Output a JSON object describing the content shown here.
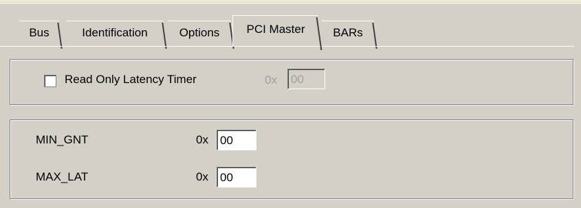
{
  "tabs": [
    {
      "label": "Bus",
      "active": false
    },
    {
      "label": "Identification",
      "active": false
    },
    {
      "label": "Options",
      "active": false
    },
    {
      "label": "PCI Master",
      "active": true
    },
    {
      "label": "BARs",
      "active": false
    }
  ],
  "latency_group": {
    "checkbox_label": "Read Only Latency Timer",
    "checkbox_checked": false,
    "hex_prefix": "0x",
    "value": "00"
  },
  "master_group": {
    "rows": [
      {
        "label": "MIN_GNT",
        "hex_prefix": "0x",
        "value": "00"
      },
      {
        "label": "MAX_LAT",
        "hex_prefix": "0x",
        "value": "00"
      }
    ]
  }
}
